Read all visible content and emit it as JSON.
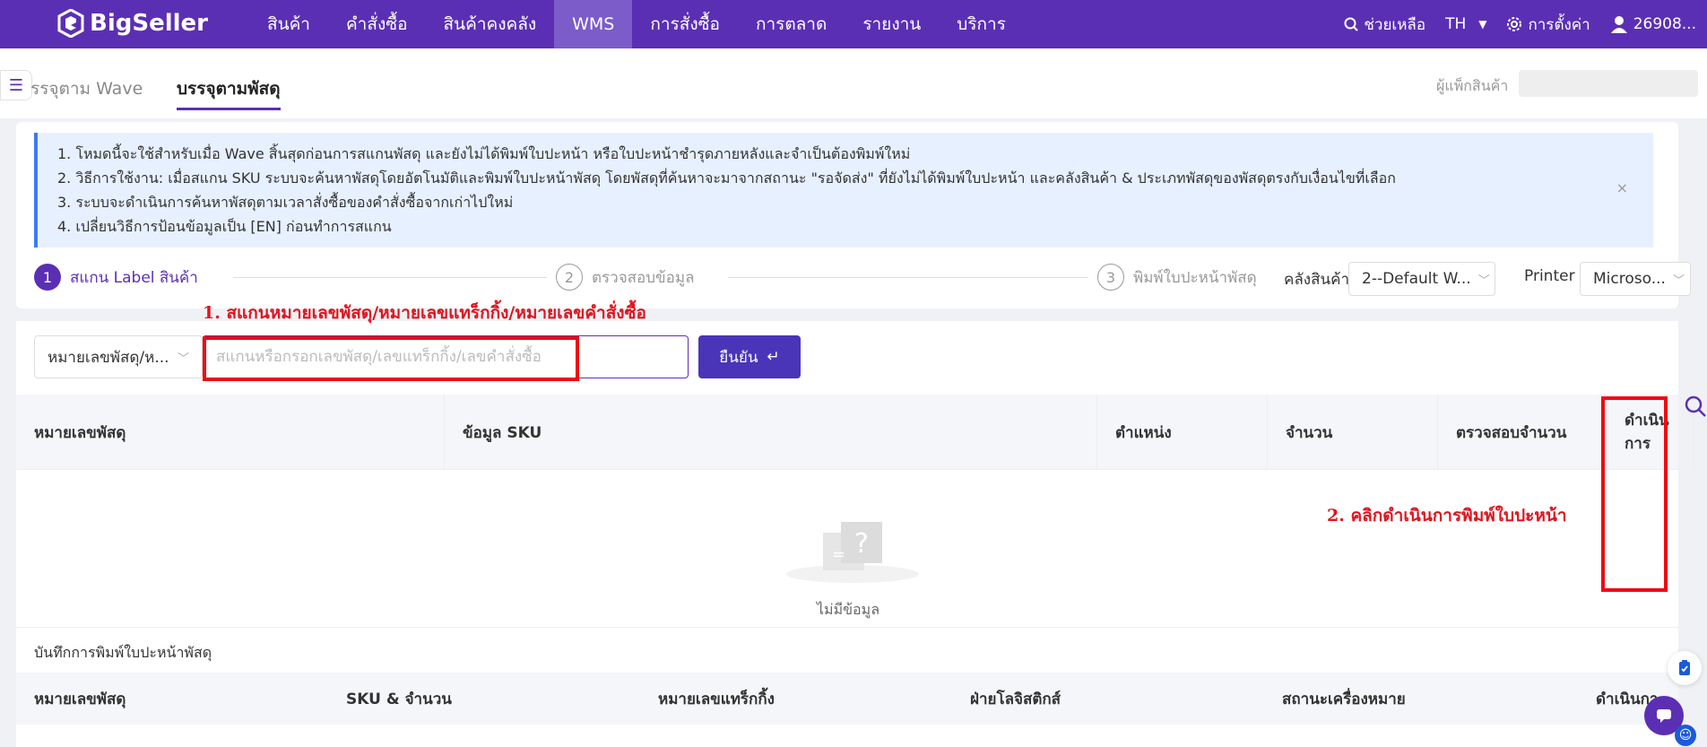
{
  "app": {
    "brand": "BigSeller"
  },
  "nav": {
    "items": [
      {
        "label": "สินค้า",
        "active": false
      },
      {
        "label": "คำสั่งซื้อ",
        "active": false
      },
      {
        "label": "สินค้าคงคลัง",
        "active": false
      },
      {
        "label": "WMS",
        "active": true
      },
      {
        "label": "การสั่งซื้อ",
        "active": false
      },
      {
        "label": "การตลาด",
        "active": false
      },
      {
        "label": "รายงาน",
        "active": false
      },
      {
        "label": "บริการ",
        "active": false
      }
    ],
    "help": "ช่วยเหลือ",
    "lang": "TH",
    "settings": "การตั้งค่า",
    "user": "26908..."
  },
  "tabs": {
    "wave": "รรจุตาม Wave",
    "parcel": "บรรจุตามพัสดุ",
    "packer_label": "ผู้แพ็กสินค้า"
  },
  "notice": {
    "lines": [
      "1. โหมดนี้จะใช้สำหรับเมื่อ Wave สิ้นสุดก่อนการสแกนพัสดุ และยังไม่ได้พิมพ์ใบปะหน้า หรือใบปะหน้าชำรุดภายหลังและจำเป็นต้องพิมพ์ใหม่",
      "2. วิธีการใช้งาน: เมื่อสแกน SKU ระบบจะค้นหาพัสดุโดยอัตโนมัติและพิมพ์ใบปะหน้าพัสดุ โดยพัสดุที่ค้นหาจะมาจากสถานะ \"รอจัดส่ง\" ที่ยังไม่ได้พิมพ์ใบปะหน้า และคลังสินค้า & ประเภทพัสดุของพัสดุตรงกับเงื่อนไขที่เลือก",
      "3. ระบบจะดำเนินการค้นหาพัสดุตามเวลาสั่งซื้อของคำสั่งซื้อจากเก่าไปใหม่",
      "4. เปลี่ยนวิธีการป้อนข้อมูลเป็น [EN] ก่อนทำการสแกน"
    ],
    "close": "×"
  },
  "steps": [
    {
      "num": "1",
      "label": "สแกน Label สินค้า"
    },
    {
      "num": "2",
      "label": "ตรวจสอบข้อมูล"
    },
    {
      "num": "3",
      "label": "พิมพ์ใบปะหน้าพัสดุ"
    }
  ],
  "warehouse": {
    "label": "คลังสินค้า",
    "value": "2--Default W..."
  },
  "printer": {
    "label": "Printer",
    "value": "Microso..."
  },
  "scan": {
    "type_value": "หมายเลขพัสดุ/ห...",
    "placeholder": "สแกนหรือกรอกเลขพัสดุ/เลขแทร็กกิ้ง/เลขคำสั่งซื้อ",
    "confirm": "ยืนยัน",
    "confirm_icon": "↵"
  },
  "table": {
    "columns": [
      "หมายเลขพัสดุ",
      "ข้อมูล SKU",
      "ตำแหน่ง",
      "จำนวน",
      "ตรวจสอบจำนวน",
      "ดำเนินการ"
    ],
    "empty": "ไม่มีข้อมูล"
  },
  "log": {
    "title": "บันทึกการพิมพ์ใบปะหน้าพัสดุ",
    "columns": [
      "หมายเลขพัสดุ",
      "SKU & จำนวน",
      "หมายเลขแทร็กกิ้ง",
      "ฝ่ายโลจิสติกส์",
      "สถานะเครื่องหมาย",
      "ดำเนินกา"
    ]
  },
  "annotations": {
    "step1": "1. สแกนหมายเลขพัสดุ/หมายเลขแทร็กกิ้ง/หมายเลขคำสั่งซื้อ",
    "step2": "2. คลิกดำเนินการพิมพ์ใบปะหน้า"
  },
  "colors": {
    "brand": "#5b2fb4",
    "annotation": "#e0141e",
    "notice_bg": "#e7f0fe"
  }
}
